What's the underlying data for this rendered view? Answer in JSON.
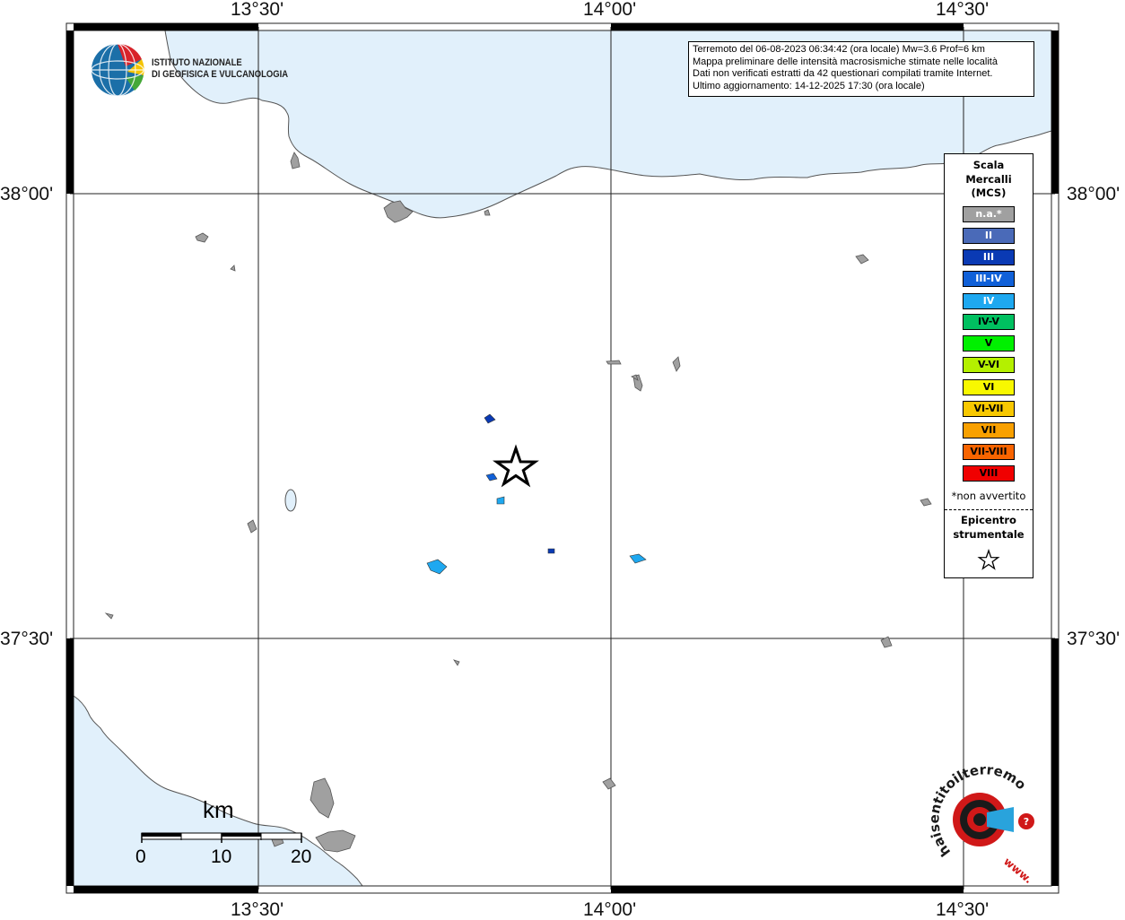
{
  "map": {
    "axis_labels": {
      "top": [
        "13°30'",
        "14°00'",
        "14°30'"
      ],
      "bottom": [
        "13°30'",
        "14°00'",
        "14°30'"
      ],
      "left": [
        "38°00'",
        "37°30'"
      ],
      "right": [
        "38°00'",
        "37°30'"
      ]
    },
    "info_box": {
      "line1": "Terremoto del 06-08-2023 06:34:42 (ora locale) Mw=3.6 Prof=6 km",
      "line2": "Mappa preliminare delle intensità macrosismiche stimate nelle località",
      "line3": "Dati non verificati estratti da 42 questionari compilati tramite Internet.",
      "line4": "Ultimo aggiornamento: 14-12-2025 17:30 (ora locale)"
    },
    "institute_logo": {
      "line1": "ISTITUTO NAZIONALE",
      "line2": "DI GEOFISICA E VULCANOLOGIA"
    },
    "legend": {
      "title_line1": "Scala",
      "title_line2": "Mercalli",
      "title_line3": "(MCS)",
      "items": [
        {
          "label": "n.a.*",
          "color": "#a0a0a0",
          "text_color": "#ffffff"
        },
        {
          "label": "II",
          "color": "#4a6ab8",
          "text_color": "#ffffff"
        },
        {
          "label": "III",
          "color": "#0a3ab4",
          "text_color": "#ffffff"
        },
        {
          "label": "III-IV",
          "color": "#1060d8",
          "text_color": "#ffffff"
        },
        {
          "label": "IV",
          "color": "#1ea8f0",
          "text_color": "#ffffff"
        },
        {
          "label": "IV-V",
          "color": "#00c060",
          "text_color": "#000000"
        },
        {
          "label": "V",
          "color": "#00f000",
          "text_color": "#000000"
        },
        {
          "label": "V-VI",
          "color": "#b4f000",
          "text_color": "#000000"
        },
        {
          "label": "VI",
          "color": "#f8f800",
          "text_color": "#000000"
        },
        {
          "label": "VI-VII",
          "color": "#f8c800",
          "text_color": "#000000"
        },
        {
          "label": "VII",
          "color": "#f8a000",
          "text_color": "#000000"
        },
        {
          "label": "VII-VIII",
          "color": "#f86400",
          "text_color": "#000000"
        },
        {
          "label": "VIII",
          "color": "#f00000",
          "text_color": "#000000"
        }
      ],
      "note": "*non avvertito",
      "epicenter_line1": "Epicentro",
      "epicenter_line2": "strumentale",
      "epicenter_symbol": "star-outline-icon"
    },
    "scale_bar": {
      "title": "km",
      "labels": [
        "0",
        "10",
        "20"
      ]
    },
    "watermark": {
      "arc_text": "haisentitoilterremoto.it",
      "url_text": "www.",
      "icon": "target-megaphone-icon",
      "accent_color": "#d01818"
    },
    "colors": {
      "sea": "#e1f0fb",
      "land": "#ffffff",
      "coast": "#555555",
      "locality_na": "#a0a0a0",
      "locality_III": "#0a3ab4",
      "locality_IV": "#1ea8f0"
    }
  }
}
